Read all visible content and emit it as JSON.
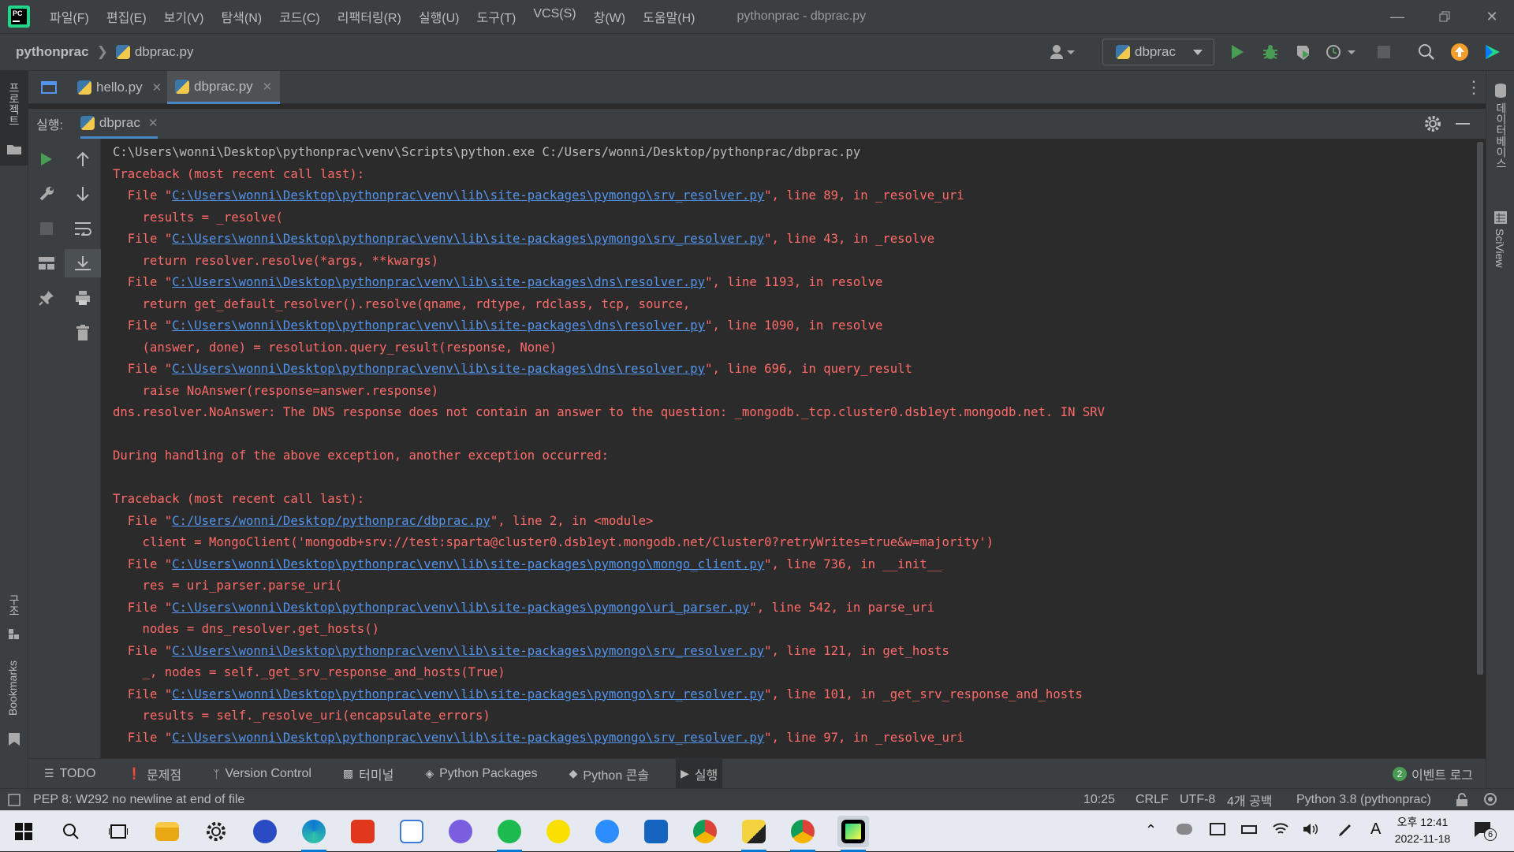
{
  "app": {
    "logo_text": "PC",
    "window_title": "pythonprac - dbprac.py",
    "menu": [
      "파일(F)",
      "편집(E)",
      "보기(V)",
      "탐색(N)",
      "코드(C)",
      "리팩터링(R)",
      "실행(U)",
      "도구(T)",
      "VCS(S)",
      "창(W)",
      "도움말(H)"
    ]
  },
  "navbar": {
    "project": "pythonprac",
    "file": "dbprac.py",
    "run_config": "dbprac"
  },
  "left_stripe": {
    "project_label": "프로젝트",
    "structure_label": "구조",
    "bookmarks_label": "Bookmarks"
  },
  "right_stripe": {
    "database_label": "데이터베이스",
    "sciview_label": "SciView"
  },
  "editor_tabs": [
    {
      "label": "hello.py",
      "active": false
    },
    {
      "label": "dbprac.py",
      "active": true
    }
  ],
  "run_panel": {
    "label": "실행:",
    "tab": "dbprac"
  },
  "console": {
    "lines": [
      {
        "kind": "cmd",
        "pre": "C:\\Users\\wonni\\Desktop\\pythonprac\\venv\\Scripts\\python.exe C:/Users/wonni/Desktop/pythonprac/dbprac.py",
        "link": "",
        "post": ""
      },
      {
        "kind": "err",
        "pre": "Traceback (most recent call last):",
        "link": "",
        "post": ""
      },
      {
        "kind": "err",
        "pre": "  File \"",
        "link": "C:\\Users\\wonni\\Desktop\\pythonprac\\venv\\lib\\site-packages\\pymongo\\srv_resolver.py",
        "post": "\", line 89, in _resolve_uri"
      },
      {
        "kind": "err",
        "pre": "    results = _resolve(",
        "link": "",
        "post": ""
      },
      {
        "kind": "err",
        "pre": "  File \"",
        "link": "C:\\Users\\wonni\\Desktop\\pythonprac\\venv\\lib\\site-packages\\pymongo\\srv_resolver.py",
        "post": "\", line 43, in _resolve"
      },
      {
        "kind": "err",
        "pre": "    return resolver.resolve(*args, **kwargs)",
        "link": "",
        "post": ""
      },
      {
        "kind": "err",
        "pre": "  File \"",
        "link": "C:\\Users\\wonni\\Desktop\\pythonprac\\venv\\lib\\site-packages\\dns\\resolver.py",
        "post": "\", line 1193, in resolve"
      },
      {
        "kind": "err",
        "pre": "    return get_default_resolver().resolve(qname, rdtype, rdclass, tcp, source,",
        "link": "",
        "post": ""
      },
      {
        "kind": "err",
        "pre": "  File \"",
        "link": "C:\\Users\\wonni\\Desktop\\pythonprac\\venv\\lib\\site-packages\\dns\\resolver.py",
        "post": "\", line 1090, in resolve"
      },
      {
        "kind": "err",
        "pre": "    (answer, done) = resolution.query_result(response, None)",
        "link": "",
        "post": ""
      },
      {
        "kind": "err",
        "pre": "  File \"",
        "link": "C:\\Users\\wonni\\Desktop\\pythonprac\\venv\\lib\\site-packages\\dns\\resolver.py",
        "post": "\", line 696, in query_result"
      },
      {
        "kind": "err",
        "pre": "    raise NoAnswer(response=answer.response)",
        "link": "",
        "post": ""
      },
      {
        "kind": "err",
        "pre": "dns.resolver.NoAnswer: The DNS response does not contain an answer to the question: _mongodb._tcp.cluster0.dsb1eyt.mongodb.net. IN SRV",
        "link": "",
        "post": ""
      },
      {
        "kind": "err",
        "pre": "",
        "link": "",
        "post": ""
      },
      {
        "kind": "err",
        "pre": "During handling of the above exception, another exception occurred:",
        "link": "",
        "post": ""
      },
      {
        "kind": "err",
        "pre": "",
        "link": "",
        "post": ""
      },
      {
        "kind": "err",
        "pre": "Traceback (most recent call last):",
        "link": "",
        "post": ""
      },
      {
        "kind": "err",
        "pre": "  File \"",
        "link": "C:/Users/wonni/Desktop/pythonprac/dbprac.py",
        "post": "\", line 2, in <module>"
      },
      {
        "kind": "err",
        "pre": "    client = MongoClient('mongodb+srv://test:sparta@cluster0.dsb1eyt.mongodb.net/Cluster0?retryWrites=true&w=majority')",
        "link": "",
        "post": ""
      },
      {
        "kind": "err",
        "pre": "  File \"",
        "link": "C:\\Users\\wonni\\Desktop\\pythonprac\\venv\\lib\\site-packages\\pymongo\\mongo_client.py",
        "post": "\", line 736, in __init__"
      },
      {
        "kind": "err",
        "pre": "    res = uri_parser.parse_uri(",
        "link": "",
        "post": ""
      },
      {
        "kind": "err",
        "pre": "  File \"",
        "link": "C:\\Users\\wonni\\Desktop\\pythonprac\\venv\\lib\\site-packages\\pymongo\\uri_parser.py",
        "post": "\", line 542, in parse_uri"
      },
      {
        "kind": "err",
        "pre": "    nodes = dns_resolver.get_hosts()",
        "link": "",
        "post": ""
      },
      {
        "kind": "err",
        "pre": "  File \"",
        "link": "C:\\Users\\wonni\\Desktop\\pythonprac\\venv\\lib\\site-packages\\pymongo\\srv_resolver.py",
        "post": "\", line 121, in get_hosts"
      },
      {
        "kind": "err",
        "pre": "    _, nodes = self._get_srv_response_and_hosts(True)",
        "link": "",
        "post": ""
      },
      {
        "kind": "err",
        "pre": "  File \"",
        "link": "C:\\Users\\wonni\\Desktop\\pythonprac\\venv\\lib\\site-packages\\pymongo\\srv_resolver.py",
        "post": "\", line 101, in _get_srv_response_and_hosts"
      },
      {
        "kind": "err",
        "pre": "    results = self._resolve_uri(encapsulate_errors)",
        "link": "",
        "post": ""
      },
      {
        "kind": "err",
        "pre": "  File \"",
        "link": "C:\\Users\\wonni\\Desktop\\pythonprac\\venv\\lib\\site-packages\\pymongo\\srv_resolver.py",
        "post": "\", line 97, in _resolve_uri"
      }
    ]
  },
  "bottom_tabs": [
    {
      "label": "TODO",
      "icon": "list-icon",
      "active": false
    },
    {
      "label": "문제점",
      "icon": "problems-icon",
      "active": false
    },
    {
      "label": "Version Control",
      "icon": "branch-icon",
      "active": false
    },
    {
      "label": "터미널",
      "icon": "terminal-icon",
      "active": false
    },
    {
      "label": "Python Packages",
      "icon": "packages-icon",
      "active": false
    },
    {
      "label": "Python 콘솔",
      "icon": "python-icon",
      "active": false
    },
    {
      "label": "실행",
      "icon": "run-icon",
      "active": true
    }
  ],
  "event_log": {
    "count": "2",
    "label": "이벤트 로그"
  },
  "status": {
    "message": "PEP 8: W292 no newline at end of file",
    "position": "10:25",
    "line_sep": "CRLF",
    "encoding": "UTF-8",
    "indent": "4개 공백",
    "interpreter": "Python 3.8 (pythonprac)"
  },
  "taskbar": {
    "time_ampm": "오후 12:41",
    "date": "2022-11-18",
    "ime": "A",
    "notif_count": "6"
  },
  "colors": {
    "accent": "#4a88c7",
    "error_text": "#ff6b68",
    "link": "#5394ec",
    "run_green": "#499c54"
  }
}
